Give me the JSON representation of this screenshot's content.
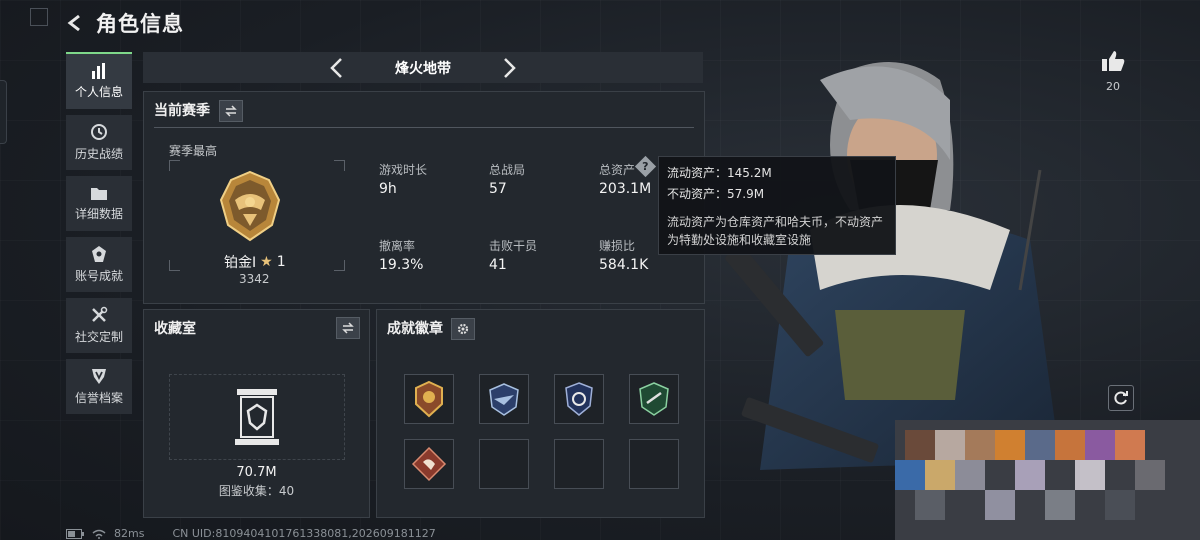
{
  "header": {
    "title": "角色信息"
  },
  "nav": {
    "items": [
      {
        "label": "个人信息",
        "icon": "bar-chart-icon",
        "active": true
      },
      {
        "label": "历史战绩",
        "icon": "clock-history-icon",
        "active": false
      },
      {
        "label": "详细数据",
        "icon": "folder-icon",
        "active": false
      },
      {
        "label": "账号成就",
        "icon": "achievement-icon",
        "active": false
      },
      {
        "label": "社交定制",
        "icon": "tools-icon",
        "active": false
      },
      {
        "label": "信誉档案",
        "icon": "shield-icon",
        "active": false
      }
    ]
  },
  "map_selector": {
    "name": "烽火地带"
  },
  "season": {
    "title": "当前赛季",
    "best_label": "赛季最高",
    "rank_name": "铂金I",
    "rank_stars": "1",
    "rank_score": "3342",
    "stats": [
      {
        "label": "游戏时长",
        "value": "9h"
      },
      {
        "label": "总战局",
        "value": "57"
      },
      {
        "label": "总资产",
        "value": "203.1M"
      },
      {
        "label": "撤离率",
        "value": "19.3%"
      },
      {
        "label": "击败干员",
        "value": "41"
      },
      {
        "label": "赚损比",
        "value": "584.1K"
      }
    ]
  },
  "tooltip": {
    "liquid": "流动资产：145.2M",
    "fixed": "不动资产：57.9M",
    "desc_line1": "流动资产为仓库资产和哈夫币，不动资产",
    "desc_line2": "为特勤处设施和收藏室设施"
  },
  "collection": {
    "title": "收藏室",
    "value": "70.7M",
    "collected": "图鉴收集：40"
  },
  "badges": {
    "title": "成就徽章",
    "slots": [
      {
        "icon": "eagle-badge-icon",
        "filled": true
      },
      {
        "icon": "winged-badge-icon",
        "filled": true
      },
      {
        "icon": "shield-badge-icon",
        "filled": true
      },
      {
        "icon": "green-emblem-badge-icon",
        "filled": true
      },
      {
        "icon": "red-diamond-badge-icon",
        "filled": true
      },
      {
        "icon": "empty-slot",
        "filled": false
      },
      {
        "icon": "empty-slot",
        "filled": false
      },
      {
        "icon": "empty-slot",
        "filled": false
      }
    ]
  },
  "like": {
    "count": "20"
  },
  "footer": {
    "ping": "82ms",
    "uid": "CN UID:8109404101761338081,202609181127"
  },
  "colors": {
    "accent": "#7fd88a",
    "panel": "#23282e",
    "rank_gold": "#d7a24a"
  }
}
